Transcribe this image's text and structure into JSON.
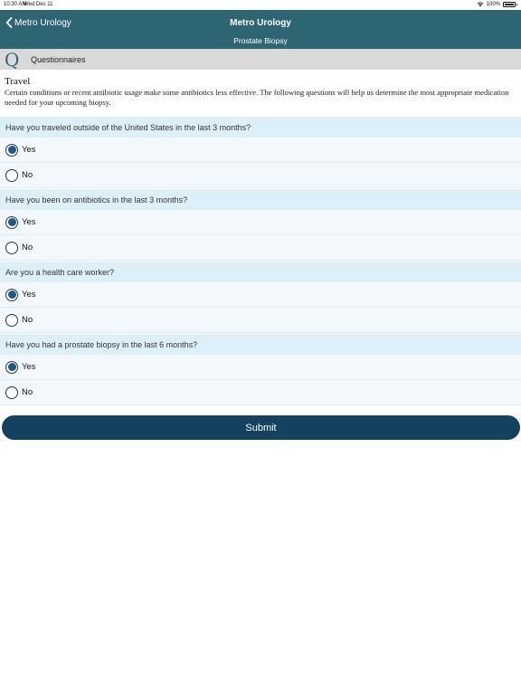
{
  "status_bar": {
    "time": "10:30 AM",
    "date": "Wed Dec 11",
    "battery": "100%"
  },
  "nav": {
    "back_label": "Metro Urology",
    "title": "Metro Urology",
    "subtitle": "Prostate Biopsy"
  },
  "section": {
    "icon_letter": "Q",
    "label": "Questionnaires"
  },
  "intro": {
    "title": "Travel",
    "text": "Certain conditions or recent antibiotic usage make some antibiotics less effective. The following questions will help us determine the most appropriate medication needed for your upcoming biopsy."
  },
  "questions": [
    {
      "text": "Have you traveled outside of the United States in the last 3 months?",
      "options": [
        "Yes",
        "No"
      ],
      "selected": "Yes"
    },
    {
      "text": "Have you been on antibiotics in the last 3 months?",
      "options": [
        "Yes",
        "No"
      ],
      "selected": "Yes"
    },
    {
      "text": "Are you a health care worker?",
      "options": [
        "Yes",
        "No"
      ],
      "selected": "Yes"
    },
    {
      "text": "Have you had a prostate biopsy in the last 6 months?",
      "options": [
        "Yes",
        "No"
      ],
      "selected": "Yes"
    }
  ],
  "submit_label": "Submit",
  "colors": {
    "nav_bg": "#2e6573",
    "question_bg": "#ddeff8",
    "option_bg": "#f2f8fb",
    "radio_fill": "#1b5a8f",
    "submit_bg": "#12425e"
  }
}
